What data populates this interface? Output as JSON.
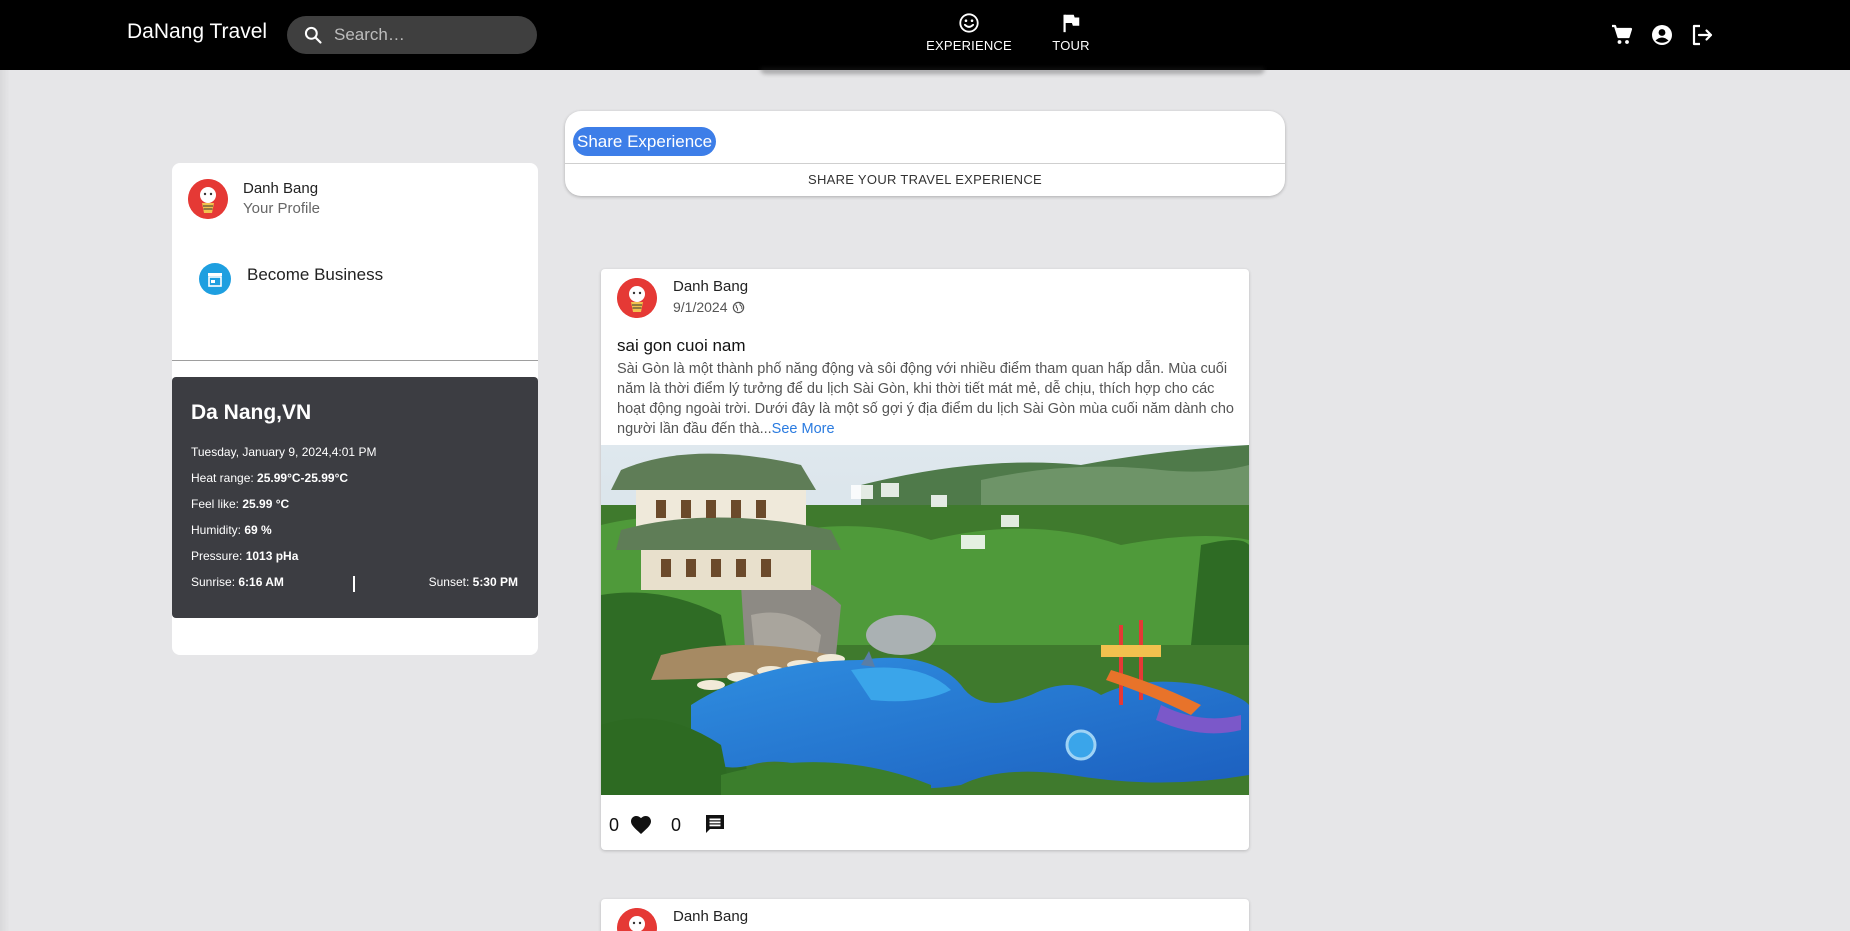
{
  "header": {
    "brand": "DaNang Travel",
    "search_placeholder": "Search…",
    "nav": [
      {
        "label": "EXPERIENCE",
        "icon": "smiley-icon"
      },
      {
        "label": "TOUR",
        "icon": "flag-icon"
      }
    ],
    "actions": [
      "cart-icon",
      "account-circle-icon",
      "logout-icon"
    ]
  },
  "sidebar": {
    "profile": {
      "name": "Danh Bang",
      "subtitle": "Your Profile"
    },
    "business": {
      "label": "Become Business",
      "icon": "store-icon"
    },
    "weather": {
      "city": "Da Nang,VN",
      "datetime": "Tuesday, January 9, 2024,4:01 PM",
      "heat_label": "Heat range: ",
      "heat_value": "25.99°C-25.99°C",
      "feel_label": "Feel like: ",
      "feel_value": "25.99 °C",
      "humidity_label": "Humidity: ",
      "humidity_value": "69 %",
      "pressure_label": "Pressure: ",
      "pressure_value": "1013 pHa",
      "sunrise_label": "Sunrise: ",
      "sunrise_value": "6:16 AM",
      "sunset_label": "Sunset: ",
      "sunset_value": "5:30 PM"
    }
  },
  "share": {
    "button_label": "Share Experience",
    "subtitle": "SHARE YOUR TRAVEL EXPERIENCE"
  },
  "posts": [
    {
      "author": "Danh Bang",
      "date": "9/1/2024",
      "title": "sai gon cuoi nam",
      "body": "Sài Gòn là một thành phố năng động và sôi động với nhiều điểm tham quan hấp dẫn. Mùa cuối năm là thời điểm lý tưởng để du lịch Sài Gòn, khi thời tiết mát mẻ, dễ chịu, thích hợp cho các hoạt động ngoài trời. Dưới đây là một số gợi ý địa điểm du lịch Sài Gòn mùa cuối năm dành cho người lần đầu đến thà...",
      "see_more": "See More",
      "likes": "0",
      "comments": "0"
    },
    {
      "author": "Danh Bang"
    }
  ],
  "colors": {
    "topbar": "#000000",
    "background": "#e6e6e8",
    "accent": "#3d7ee8",
    "weather_panel": "#3c3d42",
    "avatar": "#e53935"
  }
}
